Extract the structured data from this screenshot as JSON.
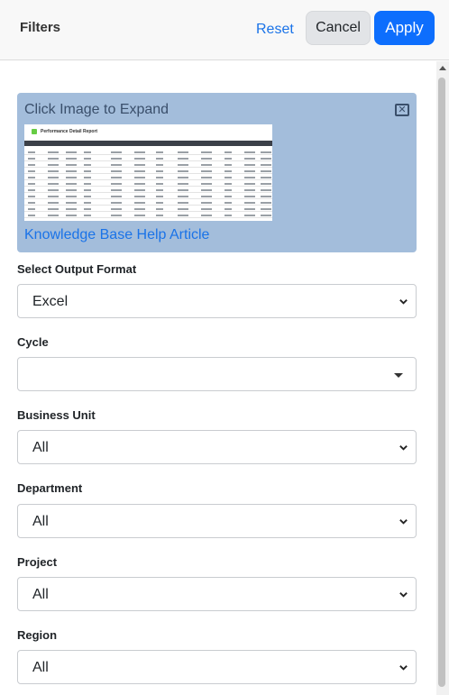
{
  "header": {
    "title": "Filters",
    "reset_label": "Reset",
    "cancel_label": "Cancel",
    "apply_label": "Apply"
  },
  "help": {
    "expand_text": "Click Image to Expand",
    "close_icon": "close-box-icon",
    "thumbnail_title": "Performance Detail Report",
    "link_text": "Knowledge Base Help Article"
  },
  "fields": {
    "output_format": {
      "label": "Select Output Format",
      "value": "Excel"
    },
    "cycle": {
      "label": "Cycle",
      "value": ""
    },
    "business_unit": {
      "label": "Business Unit",
      "value": "All"
    },
    "department": {
      "label": "Department",
      "value": "All"
    },
    "project": {
      "label": "Project",
      "value": "All"
    },
    "region": {
      "label": "Region",
      "value": "All"
    }
  },
  "colors": {
    "accent": "#0d6efd",
    "link": "#1a73e8",
    "help_panel": "#a3bddb"
  }
}
